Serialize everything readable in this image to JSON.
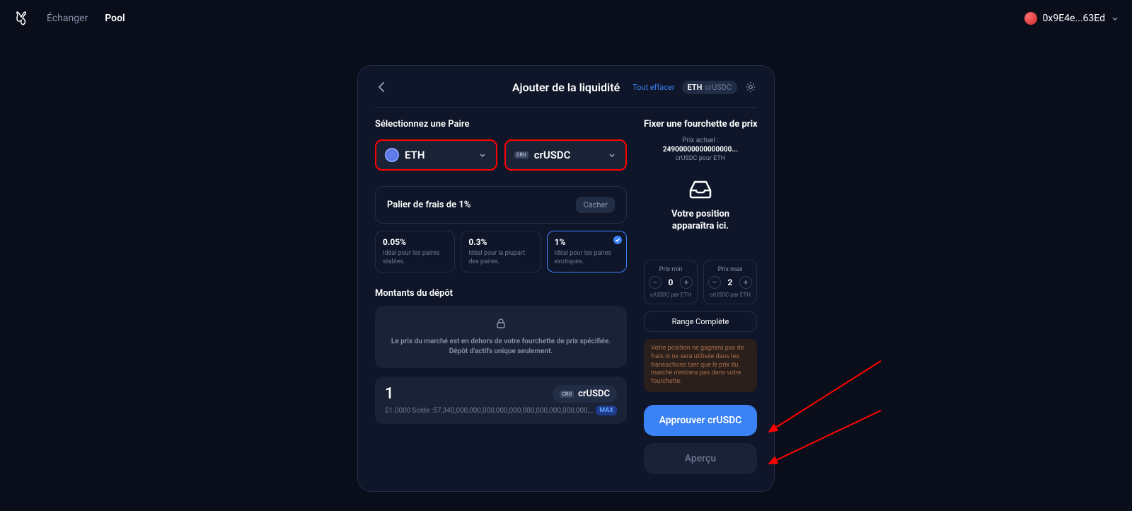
{
  "nav": {
    "swap": "Échanger",
    "pool": "Pool"
  },
  "wallet": {
    "address": "0x9E4e...63Ed"
  },
  "card": {
    "title": "Ajouter de la liquidité",
    "clear": "Tout effacer",
    "pairA": "ETH",
    "pairB": "crUSDC"
  },
  "pair": {
    "label": "Sélectionnez une Paire",
    "tokenA": "ETH",
    "tokenB": "crUSDC"
  },
  "fee": {
    "title": "Palier de frais de 1%",
    "hide": "Cacher",
    "tiers": [
      {
        "pct": "0.05%",
        "desc": "Idéal pour les paires stables."
      },
      {
        "pct": "0.3%",
        "desc": "Idéal pour la plupart des paires."
      },
      {
        "pct": "1%",
        "desc": "Idéal pour les paires exotiques."
      }
    ]
  },
  "deposit": {
    "label": "Montants du dépôt",
    "warning": "Le prix du marché est en dehors de votre fourchette de prix spécifiée. Dépôt d'actifs unique seulement.",
    "amount": "1",
    "fiat": "$1.0000",
    "balanceLabel": "Solde :",
    "balance": "57,340,000,000,000,000,000,000,000,000,000,000,000",
    "token": "crUSDC",
    "max": "MAX"
  },
  "range": {
    "title": "Fixer une fourchette de prix",
    "currentLabel": "Prix actuel :",
    "currentVal": "24900000000000000...",
    "currentUnit": "crUSDC pour ETH",
    "emptyLine1": "Votre position",
    "emptyLine2": "apparaîtra ici.",
    "minLabel": "Prix min",
    "maxLabel": "Prix max",
    "minVal": "0",
    "maxVal": "2",
    "unit": "crUSDC par ETH",
    "full": "Range Complète",
    "warn": "Votre position ne gagnera pas de frais ni ne sera utilisée dans les transactions tant que le prix du marché n'entrera pas dans votre fourchette."
  },
  "actions": {
    "approve": "Approuver crUSDC",
    "preview": "Aperçu"
  }
}
